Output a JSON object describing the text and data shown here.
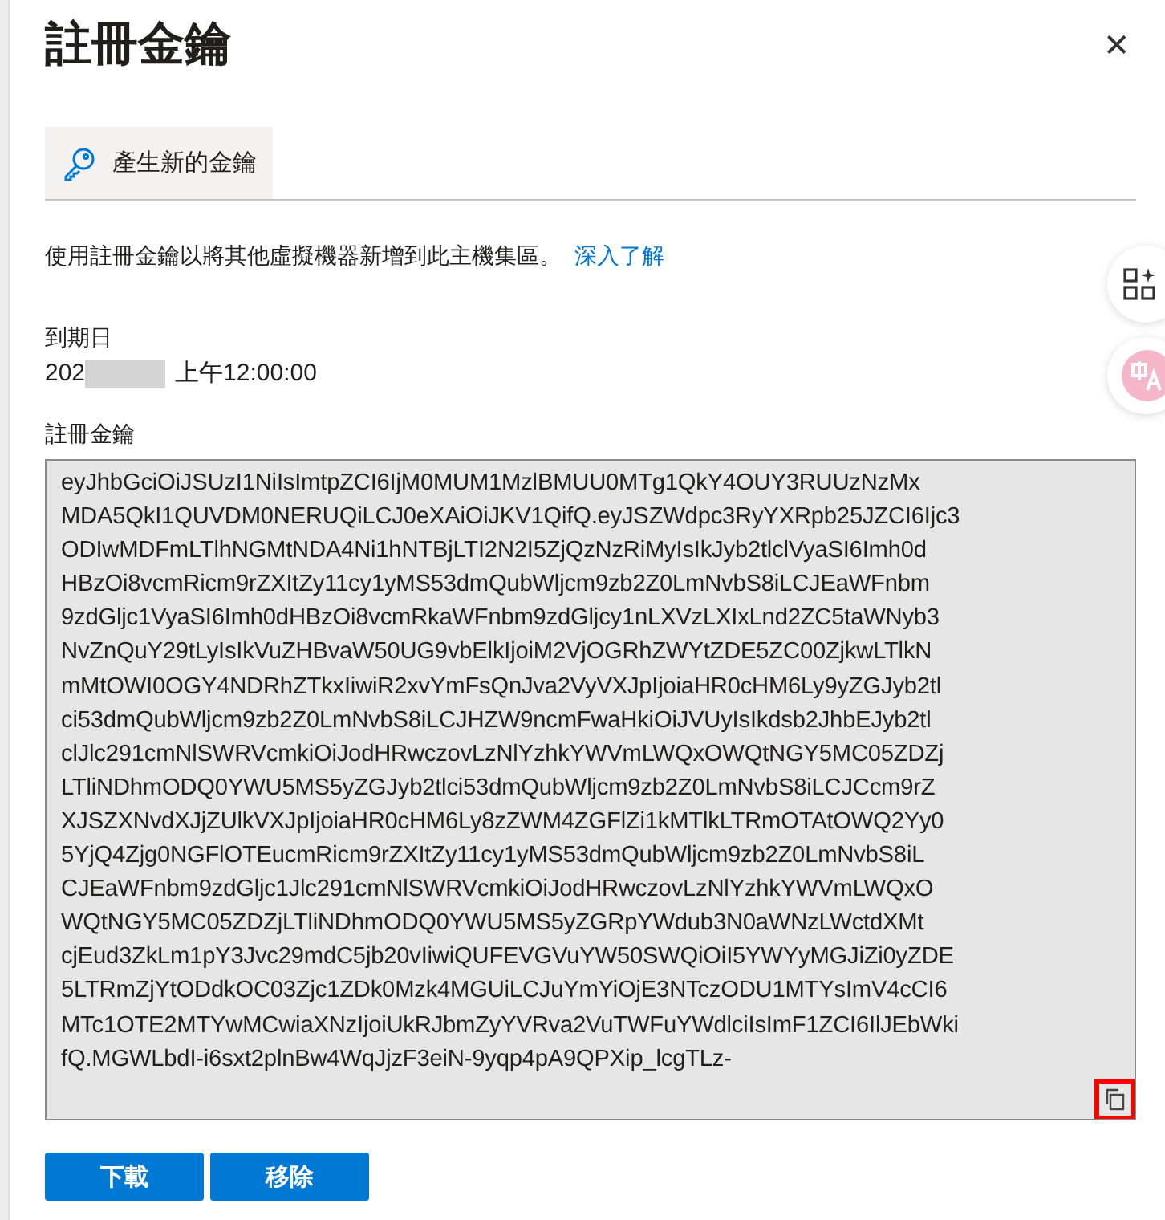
{
  "panel": {
    "title": "註冊金鑰",
    "close_label": "✕"
  },
  "toolbar": [
    {
      "kind": "key",
      "label": "產生新的金鑰"
    }
  ],
  "description": {
    "text": "使用註冊金鑰以將其他虛擬機器新增到此主機集區。",
    "link": "深入了解"
  },
  "expiry": {
    "label": "到期日",
    "value_start": "202",
    "value_end": "上午12:00:00",
    "redacted": true
  },
  "registration_key": {
    "label": "註冊金鑰",
    "lines": [
      "eyJhbGciOiJSUzI1NiIsImtpZCI6IjM0MUM1MzlBMUU0MTg1QkY4OUY3RUUzNzMx",
      "MDA5QkI1QUVDM0NERUQiLCJ0eXAiOiJKV1QifQ.eyJSZWdpc3RyYXRpb25JZCI6Ijc3",
      "ODIwMDFmLTlhNGMtNDA4Ni1hNTBjLTI2N2I5ZjQzNzRiMyIsIkJyb2tlclVyaSI6Imh0d",
      "HBzOi8vcmRicm9rZXItZy11cy1yMS53dmQubWljcm9zb2Z0LmNvbS8iLCJEaWFnbm",
      "9zdGljc1VyaSI6Imh0dHBzOi8vcmRkaWFnbm9zdGljcy1nLXVzLXIxLnd2ZC5taWNyb3",
      "NvZnQuY29tLyIsIkVuZHBvaW50UG9vbElkIjoiM2VjOGRhZWYtZDE5ZC00ZjkwLTlkN",
      "mMtOWI0OGY4NDRhZTkxIiwiR2xvYmFsQnJva2VyVXJpIjoiaHR0cHM6Ly9yZGJyb2tl",
      "ci53dmQubWljcm9zb2Z0LmNvbS8iLCJHZW9ncmFwaHkiOiJVUyIsIkdsb2JhbEJyb2tl",
      "clJlc291cmNlSWRVcmkiOiJodHRwczovLzNlYzhkYWVmLWQxOWQtNGY5MC05ZDZj",
      "LTliNDhmODQ0YWU5MS5yZGJyb2tlci53dmQubWljcm9zb2Z0LmNvbS8iLCJCcm9rZ",
      "XJSZXNvdXJjZUlkVXJpIjoiaHR0cHM6Ly8zZWM4ZGFlZi1kMTlkLTRmOTAtOWQ2Yy0",
      "5YjQ4Zjg0NGFlOTEucmRicm9rZXItZy11cy1yMS53dmQubWljcm9zb2Z0LmNvbS8iL",
      "CJEaWFnbm9zdGljc1Jlc291cmNlSWRVcmkiOiJodHRwczovLzNlYzhkYWVmLWQxO",
      "WQtNGY5MC05ZDZjLTliNDhmODQ0YWU5MS5yZGRpYWdub3N0aWNzLWctdXMt",
      "cjEud3ZkLm1pY3Jvc29mdC5jb20vIiwiQUFEVGVuYW50SWQiOiI5YWYyMGJiZi0yZDE",
      "5LTRmZjYtODdkOC03Zjc1ZDk0Mzk4MGUiLCJuYmYiOjE3NTczODU1MTYsImV4cCI6",
      "MTc1OTE2MTYwMCwiaXNzIjoiUkRJbmZyYVRva2VuTWFuYWdlciIsImF1ZCI6IlJEbWki",
      "fQ.MGWLbdI-i6sxt2plnBw4WqJjzF3eiN-9yqp4pA9QPXip_lcgTLz-"
    ],
    "copy_highlighted": true
  },
  "buttons": [
    {
      "label": "下載"
    },
    {
      "label": "移除"
    }
  ]
}
